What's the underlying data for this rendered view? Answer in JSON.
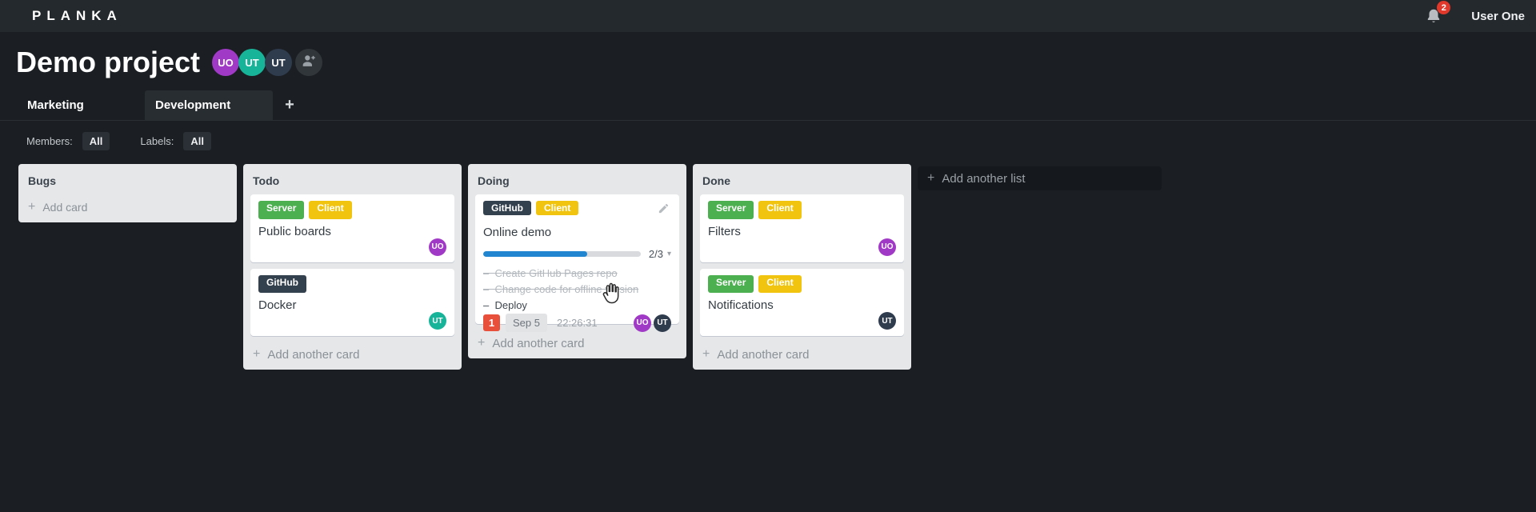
{
  "header": {
    "logo": "PLANKA",
    "notifications_count": "2",
    "user_name": "User One"
  },
  "project": {
    "title": "Demo project",
    "members": [
      {
        "initials": "UO",
        "color": "#a139c7"
      },
      {
        "initials": "UT",
        "color": "#18b499"
      },
      {
        "initials": "UT",
        "color": "#2f3c4e"
      }
    ]
  },
  "tabs": {
    "items": [
      {
        "label": "Marketing",
        "active": false
      },
      {
        "label": "Development",
        "active": true
      }
    ],
    "add_button": "+"
  },
  "filters": {
    "members_label": "Members:",
    "members_value": "All",
    "labels_label": "Labels:",
    "labels_value": "All"
  },
  "board": {
    "lists": [
      {
        "name": "Bugs",
        "footer_label": "Add card",
        "cards": []
      },
      {
        "name": "Todo",
        "footer_label": "Add another card",
        "cards": [
          {
            "title": "Public boards",
            "labels": [
              {
                "text": "Server",
                "color": "#4caf50"
              },
              {
                "text": "Client",
                "color": "#f1c40f"
              }
            ],
            "members": [
              {
                "initials": "UO",
                "color": "#a139c7"
              }
            ]
          },
          {
            "title": "Docker",
            "labels": [
              {
                "text": "GitHub",
                "color": "#33404d"
              }
            ],
            "members": [
              {
                "initials": "UT",
                "color": "#18b499"
              }
            ]
          }
        ]
      },
      {
        "name": "Doing",
        "footer_label": "Add another card",
        "cards": [
          {
            "title": "Online demo",
            "labels": [
              {
                "text": "GitHub",
                "color": "#33404d"
              },
              {
                "text": "Client",
                "color": "#f1c40f"
              }
            ],
            "progress": {
              "label": "2/3",
              "percent": 66
            },
            "tasks": [
              {
                "text": "Create GitHub Pages repo",
                "done": true
              },
              {
                "text": "Change code for offline version",
                "done": true
              },
              {
                "text": "Deploy",
                "done": false
              }
            ],
            "badges": {
              "notifications": "1",
              "due_date": "Sep 5",
              "timer": "22:26:31"
            },
            "members": [
              {
                "initials": "UO",
                "color": "#a139c7"
              },
              {
                "initials": "UT",
                "color": "#2f3c4e"
              }
            ]
          }
        ]
      },
      {
        "name": "Done",
        "footer_label": "Add another card",
        "cards": [
          {
            "title": "Filters",
            "labels": [
              {
                "text": "Server",
                "color": "#4caf50"
              },
              {
                "text": "Client",
                "color": "#f1c40f"
              }
            ],
            "members": [
              {
                "initials": "UO",
                "color": "#a139c7"
              }
            ]
          },
          {
            "title": "Notifications",
            "labels": [
              {
                "text": "Server",
                "color": "#4caf50"
              },
              {
                "text": "Client",
                "color": "#f1c40f"
              }
            ],
            "members": [
              {
                "initials": "UT",
                "color": "#2f3c4e"
              }
            ]
          }
        ]
      }
    ],
    "add_list_label": "Add another list"
  },
  "colors": {
    "topbar_bg": "#24292d",
    "board_bg": "#1b1f23",
    "list_bg": "#e5e7e9",
    "label_green": "#4caf50",
    "label_yellow": "#f1c40f",
    "label_dark": "#33404d",
    "avatar_purple": "#a139c7",
    "avatar_teal": "#18b499",
    "avatar_navy": "#2f3c4e",
    "badge_red": "#e8503c",
    "progress_blue": "#2185d0"
  }
}
